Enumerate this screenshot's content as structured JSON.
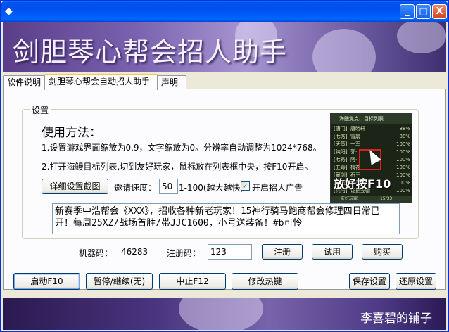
{
  "window": {
    "title": "",
    "minimize": "_",
    "maximize": "□",
    "close": "X"
  },
  "banner": {
    "title": "剑胆琴心帮会招人助手"
  },
  "tabs": [
    {
      "label": "软件说明"
    },
    {
      "label": "剑胆琴心帮会自动招人助手"
    },
    {
      "label": "声明"
    }
  ],
  "settings": {
    "group_label": "设置",
    "usage_title": "使用方法：",
    "step1": "1.设置游戏界面缩放为0.9，文字缩放为0。分辨率自动调整为1024*768。",
    "step2": "2.打开海鳗目标列表,切到友好玩家，鼠标放在列表框中央，按F10开启。",
    "detail_button": "详细设置截图",
    "speed_label": "邀请速度：",
    "speed_value": "50",
    "speed_hint": "1-100(越大越快)",
    "ad_checkbox_label": "开启招人广告",
    "ad_checked": true,
    "ad_text": "新赛季中浩帮会《XXX》，招收各种新老玩家！15神行骑马跑商帮会修理四日常已开！每周25XZ/战场首胜/帯JJC1600，小号送装备！#b可怜",
    "machine_label": "机器码：",
    "machine_code": "46283",
    "reg_label": "注册码：",
    "reg_value": "123",
    "register_button": "注册",
    "trial_button": "试用",
    "buy_button": "购买"
  },
  "preview": {
    "header": "海鳗焦点、目标列表",
    "rows": [
      {
        "school": "[唐门]",
        "name": "唐晓轩",
        "pct": "88%"
      },
      {
        "school": "[七秀]",
        "name": "雪崩",
        "pct": "88%"
      },
      {
        "school": "[天策]",
        "name": "一军",
        "pct": "100%"
      },
      {
        "school": "[纯阳]",
        "name": "郭·",
        "pct": "100%"
      },
      {
        "school": "[七秀]",
        "name": "阿·",
        "pct": "100%"
      },
      {
        "school": "[五毒]",
        "name": "梅花",
        "pct": "100%"
      },
      {
        "school": "[藏剑]",
        "name": "石王",
        "pct": "100%"
      },
      {
        "school": "[纯阳]",
        "name": "飘·",
        "pct": "100%"
      },
      {
        "school": "[纯阳]",
        "name": "证据笠帽",
        "pct": "100%"
      }
    ],
    "hint": "放好按F10",
    "footer": "友好玩家",
    "count": "15/33"
  },
  "toolbar": {
    "start": "启动F10",
    "pause": "暂停/继续(无)",
    "stop": "中止F12",
    "hotkey": "修改热键",
    "save": "保存设置",
    "restore": "还原设置"
  },
  "footer": {
    "text": "李喜碧的铺子"
  }
}
